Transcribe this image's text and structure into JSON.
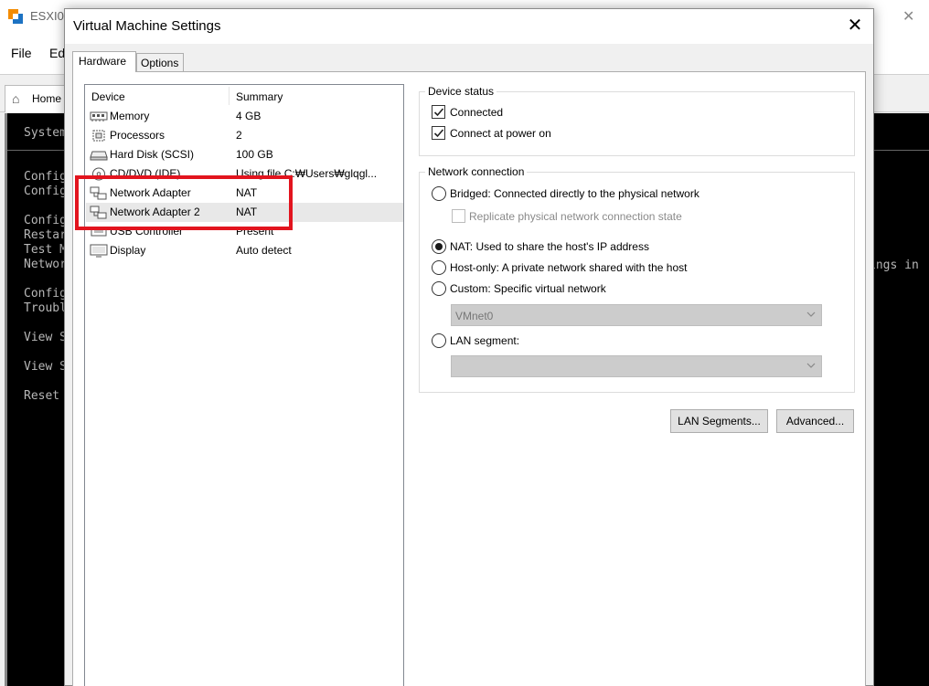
{
  "background_app": {
    "title": "ESXI0",
    "menu": [
      "File",
      "Ed"
    ],
    "home_tab": "Home",
    "console_lines": [
      "System",
      "Config",
      "Config",
      "Config",
      "Restar",
      "Test M",
      "Networ",
      "Config",
      "Troubl",
      "View S",
      "View S",
      "Reset"
    ],
    "console_right": "ings in"
  },
  "dialog": {
    "title": "Virtual Machine Settings",
    "close_glyph": "✕",
    "tabs": [
      {
        "label": "Hardware",
        "active": true
      },
      {
        "label": "Options",
        "active": false
      }
    ]
  },
  "device_list": {
    "columns": [
      "Device",
      "Summary"
    ],
    "rows": [
      {
        "icon": "memory-icon",
        "device": "Memory",
        "summary": "4 GB"
      },
      {
        "icon": "processor-icon",
        "device": "Processors",
        "summary": "2"
      },
      {
        "icon": "hard-disk-icon",
        "device": "Hard Disk (SCSI)",
        "summary": "100 GB"
      },
      {
        "icon": "cd-dvd-icon",
        "device": "CD/DVD (IDE)",
        "summary": "Using file C:₩Users₩glqgl..."
      },
      {
        "icon": "network-adapter-icon",
        "device": "Network Adapter",
        "summary": "NAT"
      },
      {
        "icon": "network-adapter-icon",
        "device": "Network Adapter 2",
        "summary": "NAT",
        "selected": true
      },
      {
        "icon": "usb-icon",
        "device": "USB Controller",
        "summary": "Present"
      },
      {
        "icon": "display-icon",
        "device": "Display",
        "summary": "Auto detect"
      }
    ]
  },
  "device_status": {
    "title": "Device status",
    "connected": {
      "label": "Connected",
      "checked": true
    },
    "connect_at_power_on": {
      "label": "Connect at power on",
      "checked": true
    }
  },
  "network_connection": {
    "title": "Network connection",
    "bridged": {
      "label": "Bridged: Connected directly to the physical network",
      "selected": false
    },
    "replicate": {
      "label": "Replicate physical network connection state",
      "checked": false,
      "disabled": true
    },
    "nat": {
      "label": "NAT: Used to share the host's IP address",
      "selected": true
    },
    "host_only": {
      "label": "Host-only: A private network shared with the host",
      "selected": false
    },
    "custom": {
      "label": "Custom: Specific virtual network",
      "selected": false
    },
    "custom_select_value": "VMnet0",
    "lan_segment": {
      "label": "LAN segment:",
      "selected": false
    },
    "lan_segment_select_value": ""
  },
  "buttons": {
    "lan_segments": "LAN Segments...",
    "advanced": "Advanced..."
  },
  "colors": {
    "highlight_box": "#e2141e",
    "console_bg": "#000000",
    "console_text": "#b8b8b8"
  }
}
